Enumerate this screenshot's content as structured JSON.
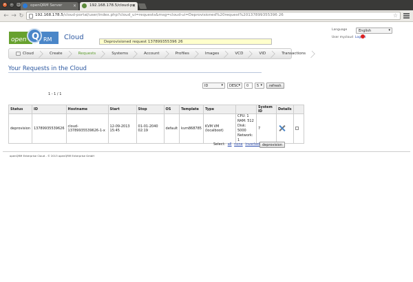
{
  "browser": {
    "tabs": [
      {
        "title": "openQRM Server"
      },
      {
        "title": "192.168.178.5/cloud-po"
      }
    ],
    "url_host": "192.168.178.5",
    "url_rest": "/cloud-portal/user/index.php?cloud_ui=requests&msg=cloud-ui=Deprovisioned%20request%20137899355396 26"
  },
  "header": {
    "logo_left": "open",
    "logo_mid": "Q",
    "logo_right": "RM",
    "title": "Cloud",
    "notice": "Deprovisioned request 137899355396 26",
    "language_label": "Language",
    "language_value": "English",
    "user_label": "User mycloud",
    "logout": "Logout"
  },
  "menu": {
    "items": [
      {
        "label": "Cloud"
      },
      {
        "label": "Create"
      },
      {
        "label": "Requests"
      },
      {
        "label": "Systems"
      },
      {
        "label": "Account"
      },
      {
        "label": "Profiles"
      },
      {
        "label": "Images"
      },
      {
        "label": "VCD"
      },
      {
        "label": "VID"
      },
      {
        "label": "Transactions"
      }
    ]
  },
  "main": {
    "heading": "Your Requests in the Cloud",
    "sort_field": "ID",
    "sort_order": "DESC",
    "offset": "0",
    "limit": "5",
    "refresh": "refresh",
    "pager": "1 - 1 / 1",
    "columns": [
      "Status",
      "ID",
      "Hostname",
      "Start",
      "Stop",
      "OS",
      "Template",
      "Type",
      "",
      "System ID",
      "Details",
      ""
    ],
    "row": {
      "status": "deprovision",
      "id": "13789935539626",
      "hostname": "cloud-13789935539626-1-x",
      "start": "12-09-2013 15:45",
      "stop": "01-01-2040 02:19",
      "os": "default",
      "template": "kvm868785",
      "type": "KVM VM (localboot)",
      "cpu": "CPU: 1",
      "ram": "RAM: 512",
      "disk": "Disk: 5000",
      "network": "Network: 1",
      "system_id": "7"
    },
    "select_label": "Select:",
    "select_all": "all",
    "select_none": "none",
    "select_inverted": "inverted",
    "deprovision": "deprovision"
  },
  "footer": {
    "text": "openQRM Enterprise Cloud - © 2013 openQRM Enterprise GmbH"
  }
}
